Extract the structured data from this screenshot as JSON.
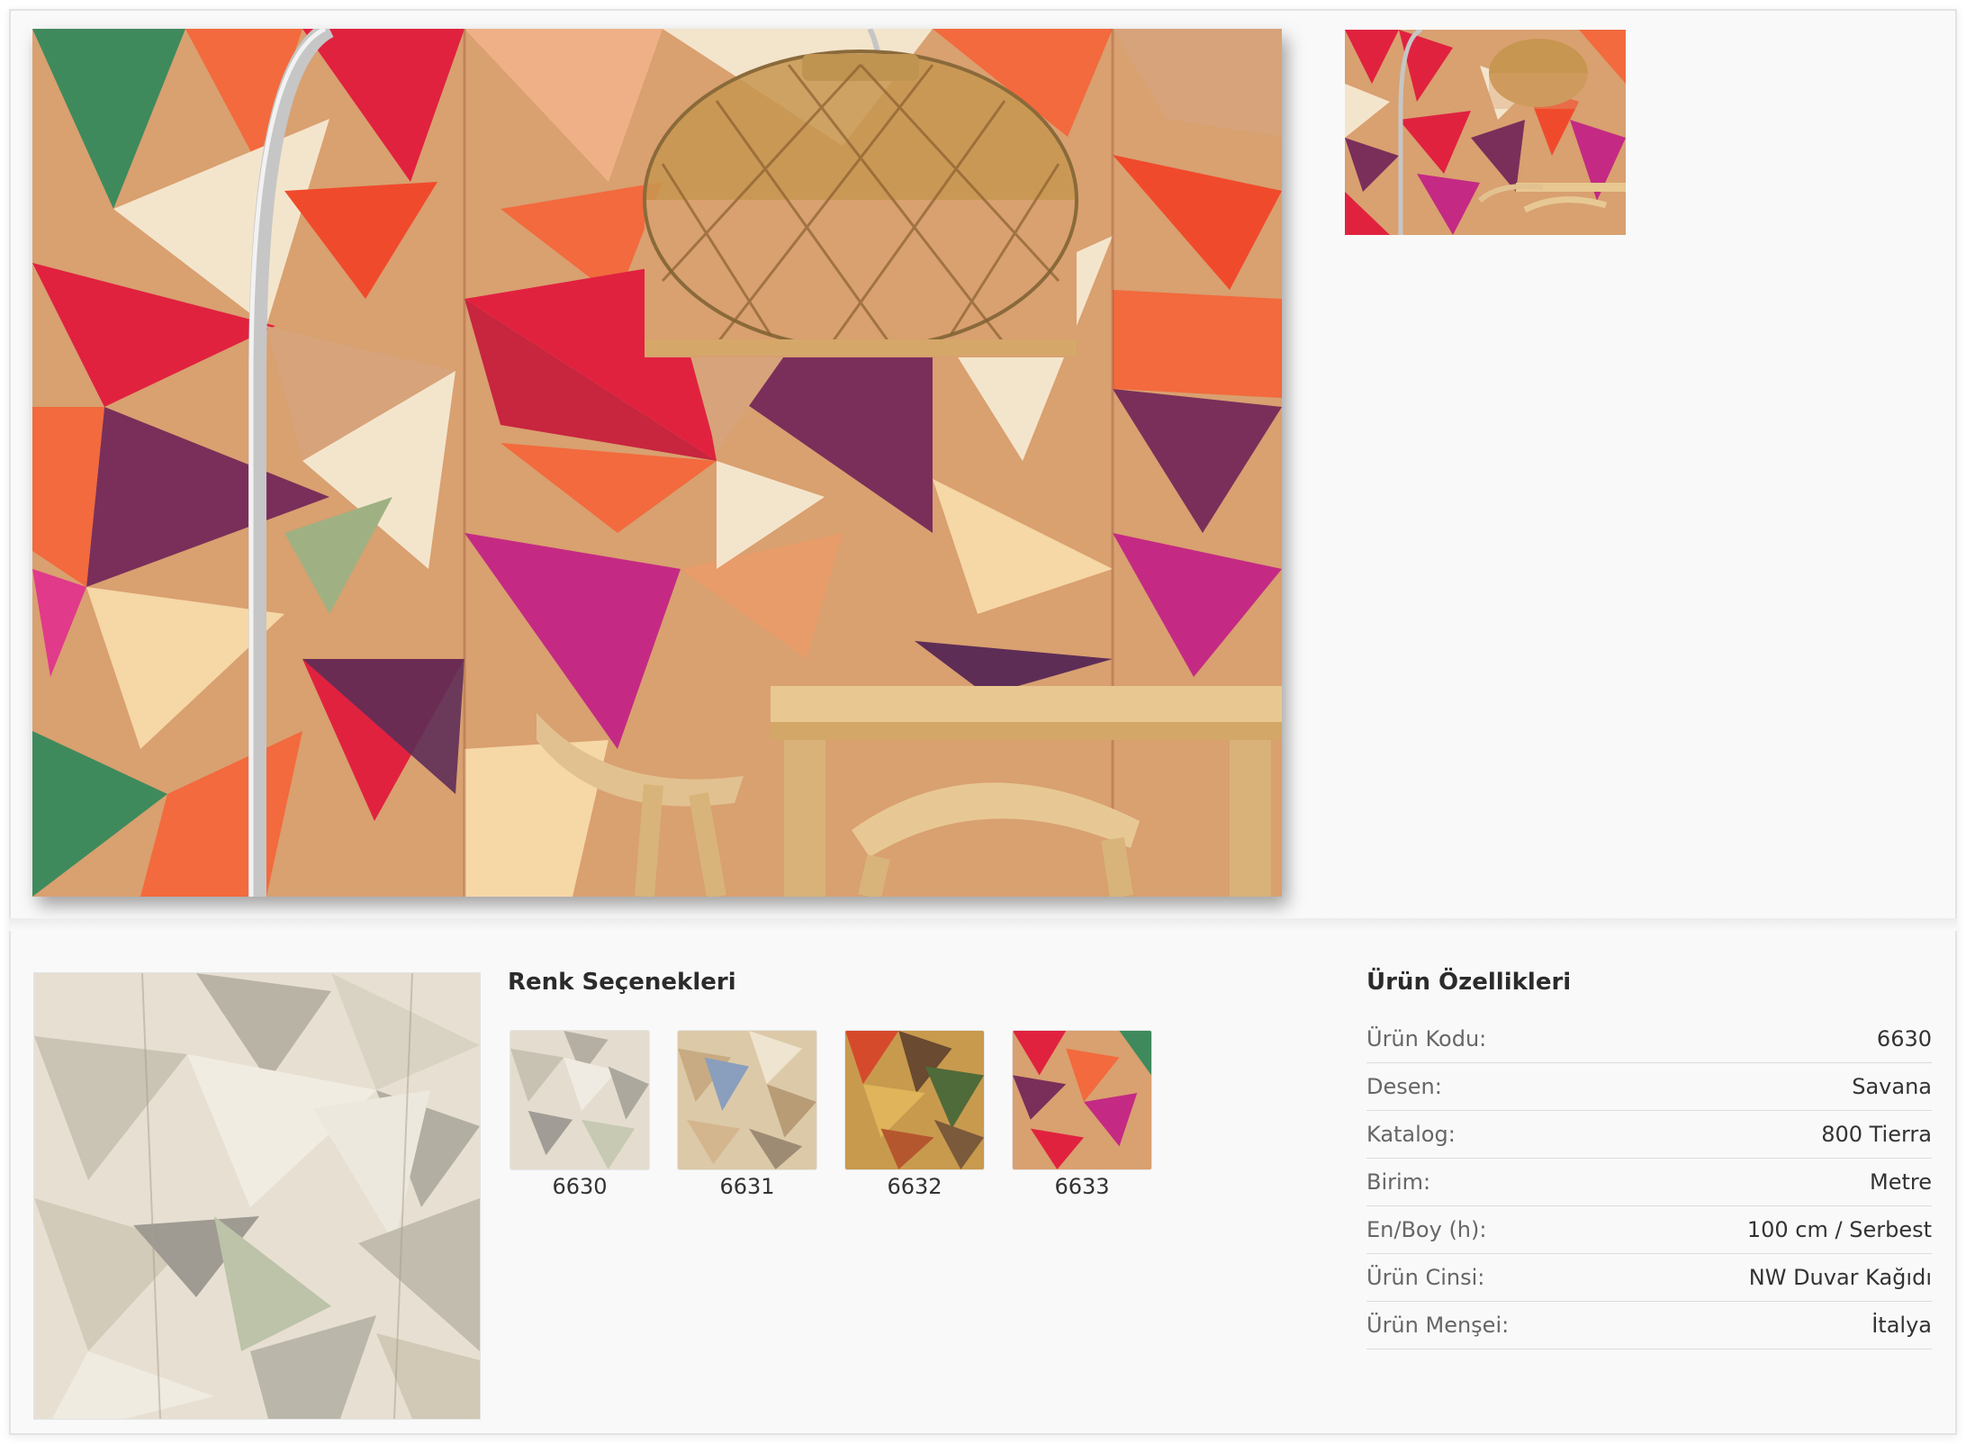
{
  "colors": {
    "title": "Renk Seçenekleri",
    "options": [
      {
        "code": "6630"
      },
      {
        "code": "6631"
      },
      {
        "code": "6632"
      },
      {
        "code": "6633"
      }
    ]
  },
  "specs": {
    "title": "Ürün Özellikleri",
    "rows": [
      {
        "label": "Ürün Kodu:",
        "value": "6630"
      },
      {
        "label": "Desen:",
        "value": "Savana"
      },
      {
        "label": "Katalog:",
        "value": "800 Tierra"
      },
      {
        "label": "Birim:",
        "value": "Metre"
      },
      {
        "label": "En/Boy (h):",
        "value": "100 cm / Serbest"
      },
      {
        "label": "Ürün Cinsi:",
        "value": "NW Duvar Kağıdı"
      },
      {
        "label": "Ürün Menşei:",
        "value": "İtalya"
      }
    ]
  },
  "palette": {
    "frame_bg": "#f9f9f9",
    "accent_red": "#e0223f",
    "accent_orange": "#f0502c",
    "accent_purple": "#7a2f5a",
    "wood": "#d9b27a"
  }
}
